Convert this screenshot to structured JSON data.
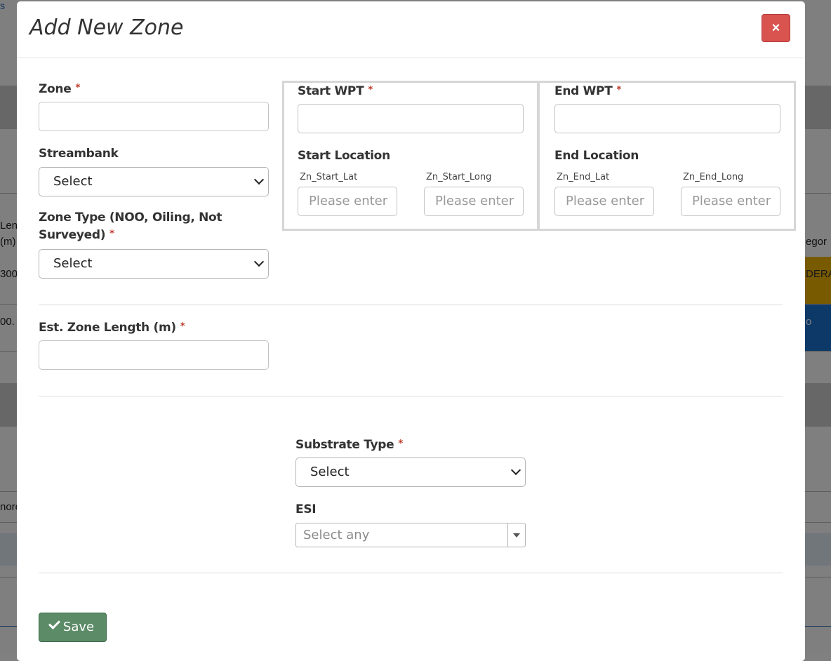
{
  "background": {
    "link_text": "s",
    "fragments": [
      "Len",
      "(m)",
      "300",
      "00.",
      "egor",
      "DERA",
      "o",
      "nore"
    ],
    "badge_colors": {
      "moderate": "#f0b400",
      "blue": "#1a73d0"
    }
  },
  "modal": {
    "title": "Add New Zone",
    "close_label": "×",
    "save_label": "Save",
    "fields": {
      "zone": {
        "label": "Zone",
        "required": "*",
        "value": ""
      },
      "streambank": {
        "label": "Streambank",
        "selected": "Select"
      },
      "zone_type": {
        "label": "Zone Type (NOO, Oiling, Not Surveyed)",
        "required": "*",
        "selected": "Select"
      },
      "start_wpt": {
        "label": "Start WPT",
        "required": "*",
        "value": ""
      },
      "end_wpt": {
        "label": "End WPT",
        "required": "*",
        "value": ""
      },
      "start_location": {
        "label": "Start Location",
        "lat_label": "Zn_Start_Lat",
        "long_label": "Zn_Start_Long",
        "lat_placeholder": "Please enter",
        "long_placeholder": "Please enter"
      },
      "end_location": {
        "label": "End Location",
        "lat_label": "Zn_End_Lat",
        "long_label": "Zn_End_Long",
        "lat_placeholder": "Please enter",
        "long_placeholder": "Please enter"
      },
      "est_length": {
        "label": "Est. Zone Length (m)",
        "required": "*",
        "value": ""
      },
      "substrate_type": {
        "label": "Substrate Type",
        "required": "*",
        "selected": "Select"
      },
      "esi": {
        "label": "ESI",
        "placeholder": "Select any"
      }
    }
  },
  "colors": {
    "close_button": "#d9534f",
    "save_button": "#5b8b67",
    "required_marker": "#c0392b"
  }
}
